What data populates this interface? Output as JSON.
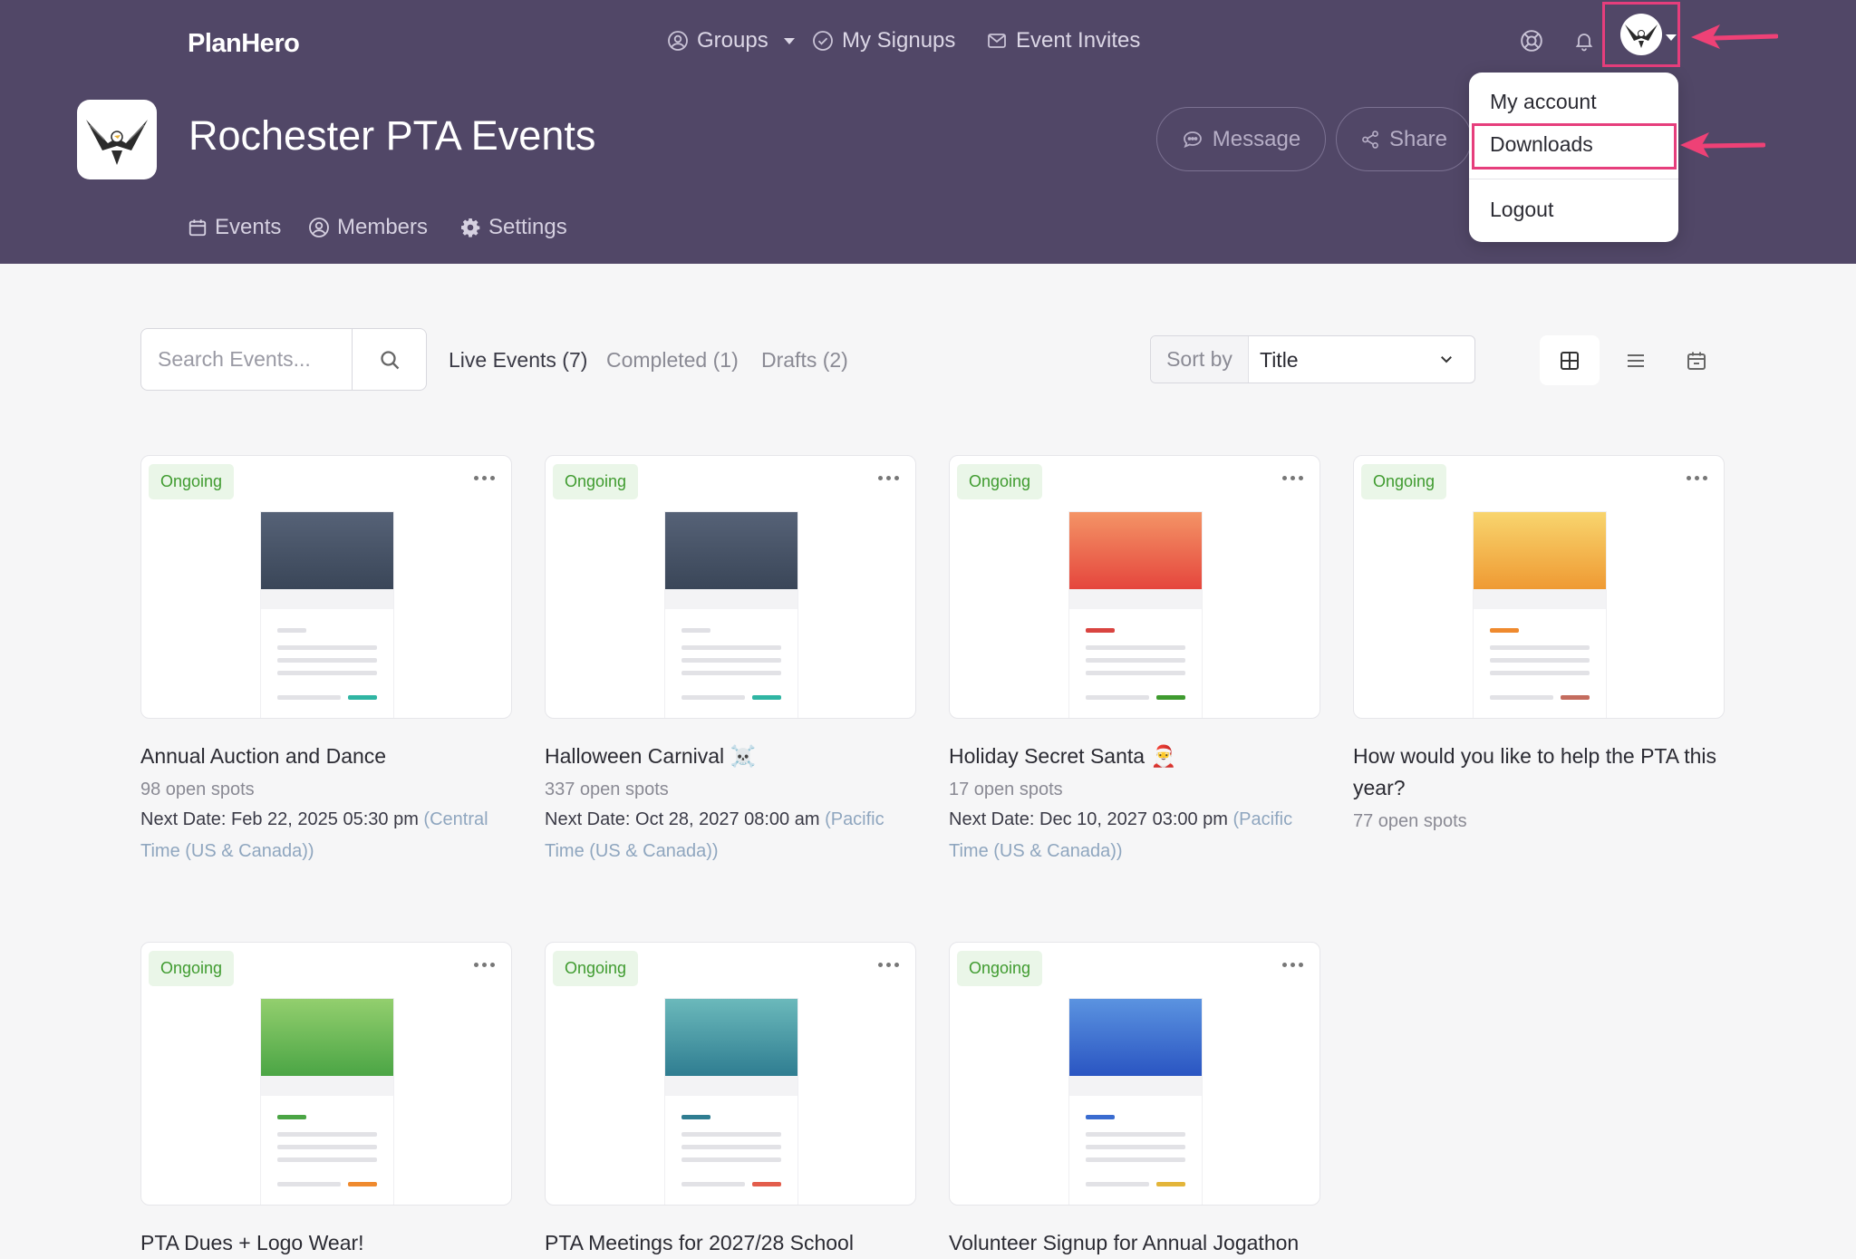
{
  "brand": "PlanHero",
  "top_nav": {
    "groups": "Groups",
    "my_signups": "My Signups",
    "event_invites": "Event Invites"
  },
  "group": {
    "title": "Rochester PTA Events"
  },
  "header_actions": {
    "message": "Message",
    "share": "Share"
  },
  "sub_nav": {
    "events": "Events",
    "members": "Members",
    "settings": "Settings"
  },
  "account_menu": {
    "items": [
      "My account",
      "Downloads",
      "Logout"
    ]
  },
  "search": {
    "placeholder": "Search Events..."
  },
  "tabs": {
    "live": "Live Events (7)",
    "completed": "Completed (1)",
    "drafts": "Drafts (2)"
  },
  "sort": {
    "label": "Sort by",
    "value": "Title"
  },
  "colors": {
    "header_bg": "#514767",
    "highlight": "#e63e7c",
    "badge_text": "#3f9b2f"
  },
  "events": [
    {
      "status": "Ongoing",
      "title": "Annual Auction and Dance",
      "spots": "98 open spots",
      "date_label": "Next Date: Feb 22, 2025 05:30 pm",
      "timezone": "(Central Time (US & Canada))",
      "theme": [
        "#566277",
        "#3a4658"
      ],
      "accent": "#2fb5a3",
      "accent2": "#e0e0e5"
    },
    {
      "status": "Ongoing",
      "title": "Halloween Carnival ☠️",
      "spots": "337 open spots",
      "date_label": "Next Date: Oct 28, 2027 08:00 am",
      "timezone": "(Pacific Time (US & Canada))",
      "theme": [
        "#566277",
        "#3a4658"
      ],
      "accent": "#2fb5a3",
      "accent2": "#e0e0e5"
    },
    {
      "status": "Ongoing",
      "title": "Holiday Secret Santa 🎅",
      "spots": "17 open spots",
      "date_label": "Next Date: Dec 10, 2027 03:00 pm",
      "timezone": "(Pacific Time (US & Canada))",
      "theme": [
        "#f49466",
        "#e5463d"
      ],
      "accent": "#3f9b2f",
      "accent2": "#d94440"
    },
    {
      "status": "Ongoing",
      "title": "How would you like to help the PTA this year?",
      "spots": "77 open spots",
      "date_label": "",
      "timezone": "",
      "theme": [
        "#f8d56e",
        "#ef9a33"
      ],
      "accent": "#c46c5e",
      "accent2": "#ef8a2e"
    },
    {
      "status": "Ongoing",
      "title": "PTA Dues + Logo Wear!",
      "spots": "",
      "date_label": "",
      "timezone": "",
      "theme": [
        "#93cf6e",
        "#4ba545"
      ],
      "accent": "#ef8a2e",
      "accent2": "#4ba545"
    },
    {
      "status": "Ongoing",
      "title": "PTA Meetings for 2027/28 School",
      "spots": "",
      "date_label": "",
      "timezone": "",
      "theme": [
        "#6bb9bb",
        "#2f7d91"
      ],
      "accent": "#e35d4c",
      "accent2": "#2f7d91"
    },
    {
      "status": "Ongoing",
      "title": "Volunteer Signup for Annual Jogathon",
      "spots": "",
      "date_label": "",
      "timezone": "",
      "theme": [
        "#5b93e0",
        "#2a55c2"
      ],
      "accent": "#e3b53a",
      "accent2": "#3a6cd0"
    }
  ]
}
